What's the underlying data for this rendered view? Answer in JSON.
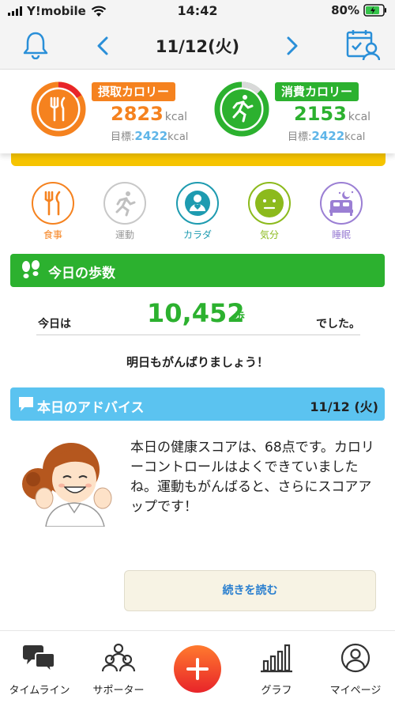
{
  "status_bar": {
    "carrier": "Y!mobile",
    "time": "14:42",
    "battery": "80%"
  },
  "header": {
    "date": "11/12(火)"
  },
  "calories": {
    "intake": {
      "label": "摂取カロリー",
      "value": "2823",
      "unit": "kcal",
      "goal_prefix": "目標:",
      "goal_value": "2422",
      "goal_unit": "kcal",
      "color": "#f5821f"
    },
    "burn": {
      "label": "消費カロリー",
      "value": "2153",
      "unit": "kcal",
      "goal_prefix": "目標:",
      "goal_value": "2422",
      "goal_unit": "kcal",
      "color": "#2cb12f"
    }
  },
  "categories": [
    {
      "label": "食事",
      "icon": "fork-knife-icon",
      "color": "#f5821f"
    },
    {
      "label": "運動",
      "icon": "running-person-icon",
      "color": "#b0b0b0"
    },
    {
      "label": "カラダ",
      "icon": "person-heart-icon",
      "color": "#1e9bb0"
    },
    {
      "label": "気分",
      "icon": "face-icon",
      "color": "#8cba1c"
    },
    {
      "label": "睡眠",
      "icon": "bed-moon-icon",
      "color": "#9b7fd4"
    }
  ],
  "steps": {
    "title": "今日の歩数",
    "prefix": "今日は",
    "value": "10,452",
    "unit": "歩",
    "suffix": "でした。",
    "cheer": "明日もがんばりましょう！"
  },
  "advice": {
    "title": "本日のアドバイス",
    "date": "11/12 (火)",
    "text": "本日の健康スコアは、68点です。カロリーコントロールはよくできていましたね。運動もがんばると、さらにスコアアップです！",
    "read_more": "続きを読む"
  },
  "tabbar": {
    "timeline": "タイムライン",
    "supporter": "サポーター",
    "graph": "グラフ",
    "mypage": "マイページ"
  }
}
